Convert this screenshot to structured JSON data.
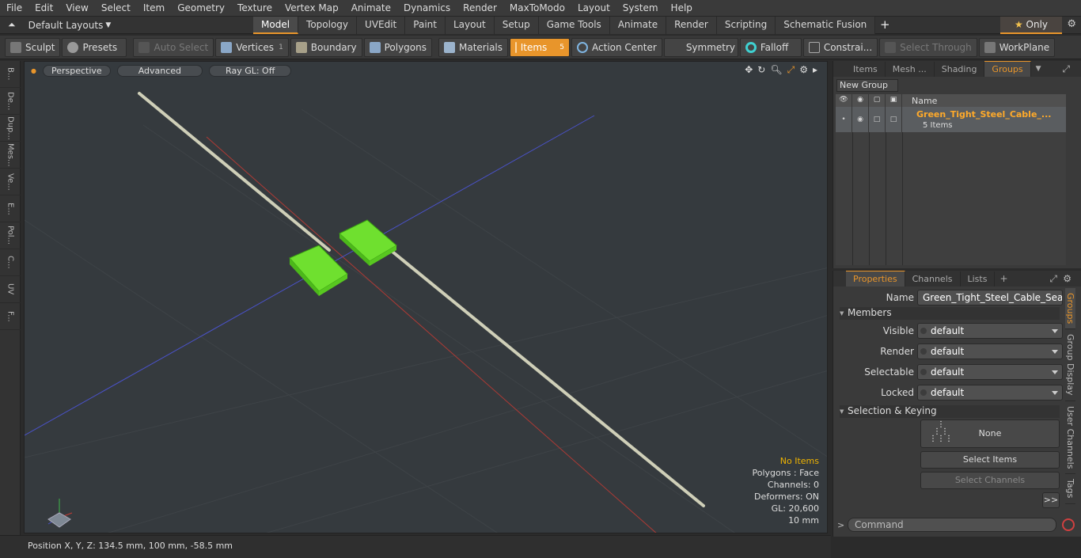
{
  "menu": [
    "File",
    "Edit",
    "View",
    "Select",
    "Item",
    "Geometry",
    "Texture",
    "Vertex Map",
    "Animate",
    "Dynamics",
    "Render",
    "MaxToModo",
    "Layout",
    "System",
    "Help"
  ],
  "layouts_label": "Default Layouts",
  "mode_tabs": [
    "Model",
    "Topology",
    "UVEdit",
    "Paint",
    "Layout",
    "Setup",
    "Game Tools",
    "Animate",
    "Render",
    "Scripting",
    "Schematic Fusion"
  ],
  "only_label": "Only",
  "toolbar": {
    "sculpt": "Sculpt",
    "presets": "Presets",
    "auto_select": "Auto Select",
    "vertices": "Vertices",
    "vertices_count": "1",
    "boundary": "Boundary",
    "polygons": "Polygons",
    "materials": "Materials",
    "items": "Items",
    "items_count": "5",
    "action_center": "Action Center",
    "symmetry": "Symmetry",
    "falloff": "Falloff",
    "constraints": "Constrai...",
    "select_through": "Select Through",
    "workplane": "WorkPlane"
  },
  "left_tabs": [
    "B...",
    "De...",
    "Dup...",
    "Mes...",
    "Ve...",
    "E...",
    "Pol...",
    "C...",
    "UV",
    "F..."
  ],
  "viewport": {
    "view": "Perspective",
    "advanced": "Advanced",
    "raygl": "Ray GL: Off",
    "hud": {
      "no_items": "No Items",
      "polygons": "Polygons : Face",
      "channels": "Channels: 0",
      "deformers": "Deformers: ON",
      "gl": "GL: 20,600",
      "scale": "10 mm"
    }
  },
  "status": "Position X, Y, Z:   134.5 mm, 100 mm, -58.5 mm",
  "groups_panel": {
    "tabs": [
      "Items",
      "Mesh ...",
      "Shading",
      "Groups"
    ],
    "new_group": "New Group",
    "col_name": "Name",
    "group_name": "Green_Tight_Steel_Cable_...",
    "group_items": "5 Items"
  },
  "properties": {
    "tabs": [
      "Properties",
      "Channels",
      "Lists"
    ],
    "name_label": "Name",
    "name_value": "Green_Tight_Steel_Cable_Seal_St",
    "members": "Members",
    "visible_label": "Visible",
    "visible": "default",
    "render_label": "Render",
    "render": "default",
    "selectable_label": "Selectable",
    "selectable": "default",
    "locked_label": "Locked",
    "locked": "default",
    "selection_keying": "Selection & Keying",
    "none": "None",
    "select_items": "Select Items",
    "select_channels": "Select Channels",
    "more": ">>",
    "side_tabs": [
      "Groups",
      "Group Display",
      "User Channels",
      "Tags"
    ]
  },
  "command_placeholder": "Command"
}
